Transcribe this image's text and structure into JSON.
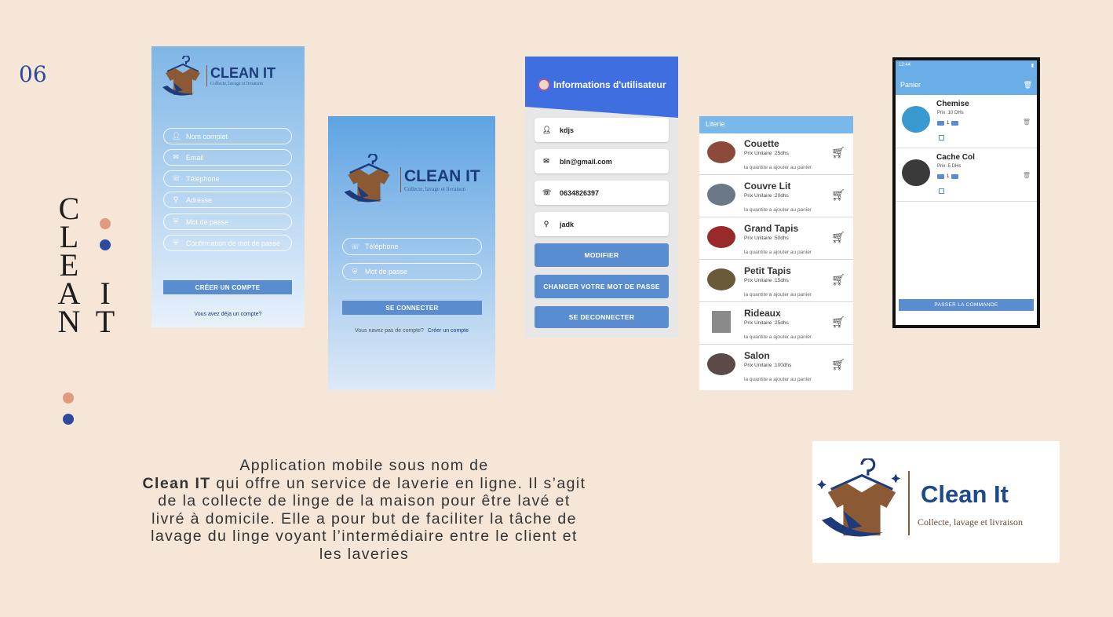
{
  "page_number": "06",
  "vertical_title": {
    "word1": [
      "C",
      "L",
      "E",
      "A",
      "N"
    ],
    "word2": [
      "I",
      "T"
    ]
  },
  "colors": {
    "accent_orange": "#e09a7e",
    "accent_blue": "#2b4aa0",
    "button_blue": "#5a8dd0"
  },
  "brand": {
    "name_upper": "CLEAN IT",
    "tagline": "Collecte, lavage et livraison",
    "name_title": "Clean It"
  },
  "signup_screen": {
    "fields": [
      {
        "icon": "user-icon",
        "placeholder": "Nom complet"
      },
      {
        "icon": "mail-icon",
        "placeholder": "Email"
      },
      {
        "icon": "phone-icon",
        "placeholder": "Téléphone"
      },
      {
        "icon": "location-icon",
        "placeholder": "Adresse"
      },
      {
        "icon": "shield-icon",
        "placeholder": "Mot de passe"
      },
      {
        "icon": "shield-icon",
        "placeholder": "Confirmation de mot de passe"
      }
    ],
    "button": "CRÉER UN COMPTE",
    "link": "Vous avez déja un compte?"
  },
  "login_screen": {
    "fields": [
      {
        "icon": "phone-icon",
        "placeholder": "Téléphone"
      },
      {
        "icon": "shield-icon",
        "placeholder": "Mot de passe"
      }
    ],
    "button": "SE CONNECTER",
    "link_text": "Vous navez pas de compte?",
    "link_action": "Créer un compte"
  },
  "profile_screen": {
    "title": "Informations d'utilisateur",
    "fields": [
      {
        "icon": "user-icon",
        "value": "kdjs"
      },
      {
        "icon": "mail-icon",
        "value": "bln@gmail.com"
      },
      {
        "icon": "phone-icon",
        "value": "0634826397"
      },
      {
        "icon": "location-icon",
        "value": "jadk"
      }
    ],
    "buttons": [
      "MODIFIER",
      "CHANGER VOTRE MOT DE PASSE",
      "SE DECONNECTER"
    ]
  },
  "category_screen": {
    "title": "Literie",
    "items": [
      {
        "name": "Couette",
        "price": "Prix Unitaire :25dhs",
        "add": "la quantite a ajouter au panier",
        "color": "#8b4a3a"
      },
      {
        "name": "Couvre Lit",
        "price": "Prix Unitaire :20dhs",
        "add": "la quantite a ajouter au panier",
        "color": "#6a7888"
      },
      {
        "name": "Grand Tapis",
        "price": "Prix Unitaire :50dhs",
        "add": "la quantite a ajouter au panier",
        "color": "#9a2a2a"
      },
      {
        "name": "Petit Tapis",
        "price": "Prix Unitaire :15dhs",
        "add": "la quantite a ajouter au panier",
        "color": "#6a5a3a"
      },
      {
        "name": "Rideaux",
        "price": "Prix Unitaire :25dhs",
        "add": "la quantite a ajouter au panier",
        "color": "#8a8a8a"
      },
      {
        "name": "Salon",
        "price": "Prix Unitaire :100dhs",
        "add": "la quantite a ajouter au panier",
        "color": "#5a4a4a"
      }
    ]
  },
  "cart_screen": {
    "time": "12:44",
    "title": "Panier",
    "items": [
      {
        "name": "Chemise",
        "price": "Prix :10 DHs",
        "qty": "1",
        "color": "#3a9ad0"
      },
      {
        "name": "Cache Col",
        "price": "Prix :5 DHs",
        "qty": "1",
        "color": "#3a3a3a"
      }
    ],
    "button": "PASSER LA COMMANDE"
  },
  "description": {
    "line1": "Application mobile sous nom de",
    "brand": "Clean IT",
    "rest": " qui offre un service de laverie en ligne. Il s’agit de la collecte de linge de la maison pour être lavé et livré à domicile. Elle a pour but de faciliter la tâche de lavage du linge voyant l’intermédiaire entre le client et les laveries"
  }
}
